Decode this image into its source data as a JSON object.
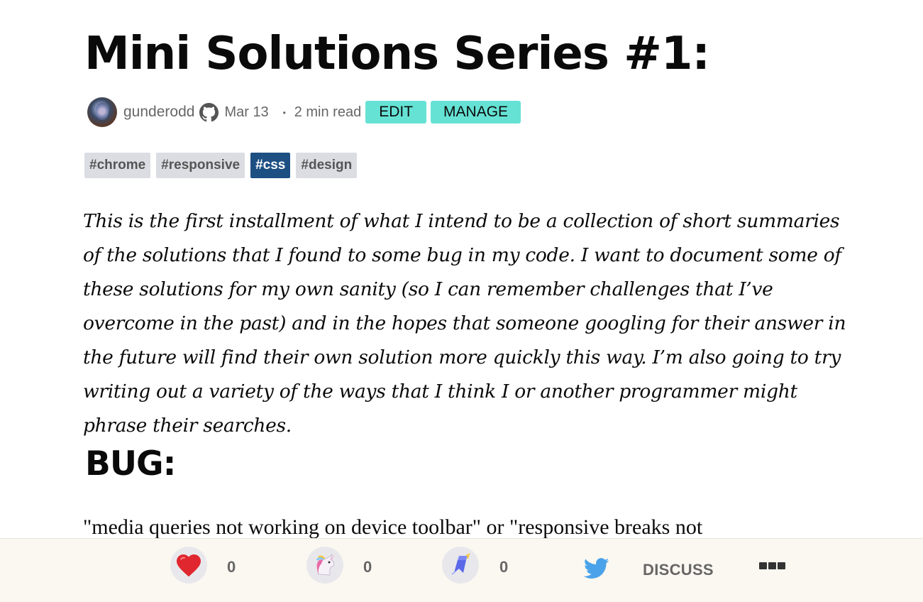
{
  "article": {
    "title": "Mini Solutions Series #1:",
    "author": {
      "username": "gunderodd",
      "date": "Mar 13",
      "read_time_separator": "・",
      "read_time": "2 min read"
    },
    "actions": {
      "edit_label": "EDIT",
      "manage_label": "MANAGE"
    },
    "tags": [
      "#chrome",
      "#responsive",
      "#css",
      "#design"
    ],
    "intro": "This is the first installment of what I intend to be a collection of short summaries of the solutions that I found to some bug in my code. I want to document some of these solutions for my own sanity (so I can remember challenges that I’ve overcome in the past) and in the hopes that someone googling for their answer in the future will find their own solution more quickly this way. I’m also going to try writing out a variety of the ways that I think I or another programmer might phrase their searches.",
    "section_heading": "BUG:",
    "section_text": "\"media queries not working on device toolbar\" or \"responsive breaks not"
  },
  "footer": {
    "reactions": [
      {
        "icon": "heart-icon",
        "count": "0"
      },
      {
        "icon": "unicorn-icon",
        "count": "0"
      },
      {
        "icon": "bookmark-icon",
        "count": "0"
      }
    ],
    "discuss_label": "DISCUSS",
    "share_icon": "twitter-icon",
    "more_icon": "more-icon"
  },
  "colors": {
    "button_bg": "#66e2d5",
    "tag_bg": "#dbdde3",
    "tag_css_bg": "#1d4f83",
    "footer_bg": "#fbf8f1",
    "heart": "#e0272f",
    "twitter": "#4aa3ea"
  }
}
